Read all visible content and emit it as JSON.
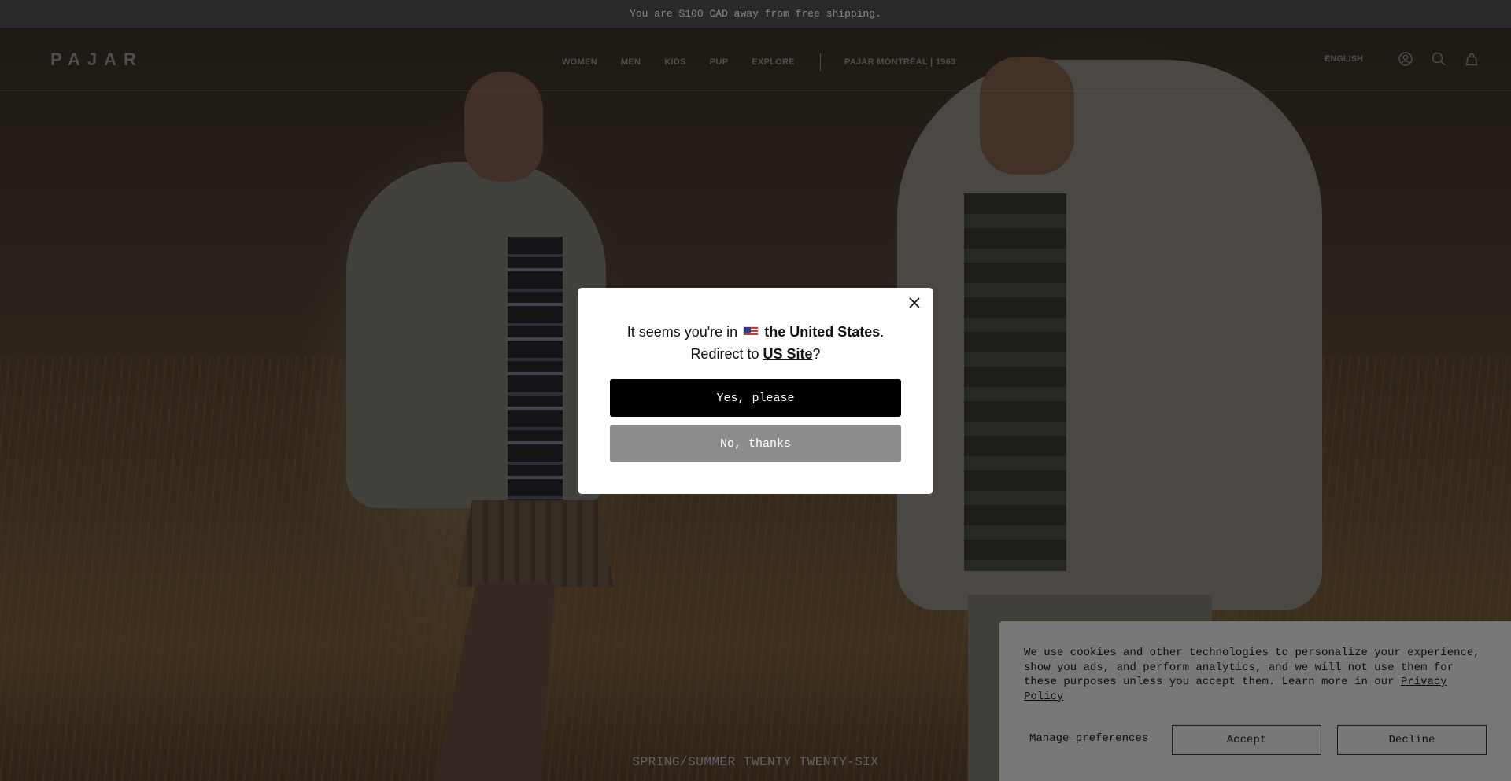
{
  "announcement": {
    "text": "You are $100 CAD away from free shipping."
  },
  "header": {
    "logo": "PAJAR",
    "nav": [
      {
        "label": "WOMEN"
      },
      {
        "label": "MEN"
      },
      {
        "label": "KIDS"
      },
      {
        "label": "PUP"
      },
      {
        "label": "EXPLORE"
      }
    ],
    "brand_link": "PAJAR MONTRÉAL | 1963",
    "language": "ENGLISH",
    "icons": [
      "account-icon",
      "search-icon",
      "cart-icon"
    ]
  },
  "hero": {
    "caption": "SPRING/SUMMER TWENTY TWENTY-SIX"
  },
  "geo_modal": {
    "line1_prefix": "It seems you're in",
    "country": "the United States",
    "line1_suffix": ".",
    "line2_prefix": "Redirect to",
    "site_link": "US Site",
    "line2_suffix": "?",
    "yes_label": "Yes, please",
    "no_label": "No, thanks",
    "flag_icon": "us-flag-icon"
  },
  "cookie_banner": {
    "text": "We use cookies and other technologies to personalize your experience, show you ads, and perform analytics, and we will not use them for these purposes unless you accept them. Learn more in our",
    "policy_link": "Privacy Policy",
    "manage_label": "Manage preferences",
    "accept_label": "Accept",
    "decline_label": "Decline"
  },
  "colors": {
    "modal_primary": "#000000",
    "modal_secondary": "#8c8c8c",
    "cookie_bg": "#787878",
    "announce_bg": "#3b3b3b"
  }
}
